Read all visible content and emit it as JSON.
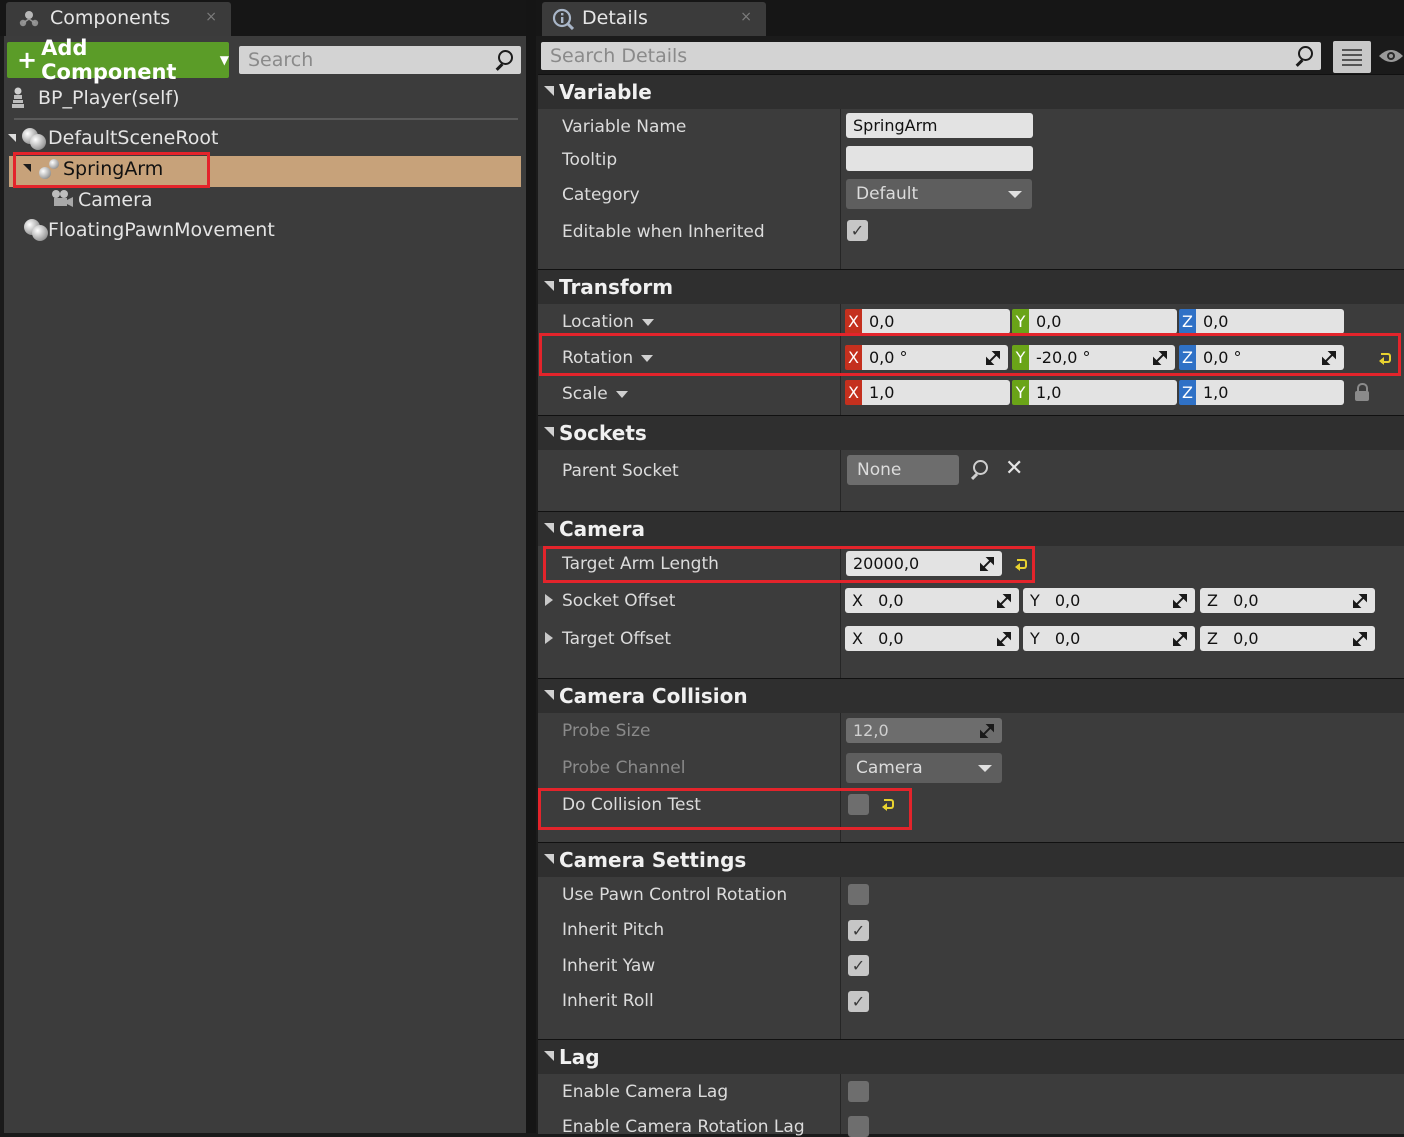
{
  "components_panel": {
    "tab_title": "Components",
    "tab_close": "×",
    "add_component_label": "Add Component",
    "search_placeholder": "Search",
    "self_item": "BP_Player(self)",
    "tree": [
      {
        "label": "DefaultSceneRoot"
      },
      {
        "label": "SpringArm",
        "selected": true
      },
      {
        "label": "Camera"
      },
      {
        "label": "FloatingPawnMovement"
      }
    ]
  },
  "details_panel": {
    "tab_title": "Details",
    "tab_close": "×",
    "search_placeholder": "Search Details",
    "sections": {
      "variable": {
        "title": "Variable",
        "variable_name_label": "Variable Name",
        "variable_name_value": "SpringArm",
        "tooltip_label": "Tooltip",
        "tooltip_value": "",
        "category_label": "Category",
        "category_value": "Default",
        "editable_label": "Editable when Inherited",
        "editable_checked": true
      },
      "transform": {
        "title": "Transform",
        "location_label": "Location",
        "location": {
          "x": "0,0",
          "y": "0,0",
          "z": "0,0"
        },
        "rotation_label": "Rotation",
        "rotation": {
          "x": "0,0 °",
          "y": "-20,0 °",
          "z": "0,0 °"
        },
        "scale_label": "Scale",
        "scale": {
          "x": "1,0",
          "y": "1,0",
          "z": "1,0"
        },
        "axis_x": "X",
        "axis_y": "Y",
        "axis_z": "Z"
      },
      "sockets": {
        "title": "Sockets",
        "parent_socket_label": "Parent Socket",
        "parent_socket_value": "None"
      },
      "camera": {
        "title": "Camera",
        "target_arm_length_label": "Target Arm Length",
        "target_arm_length_value": "20000,0",
        "socket_offset_label": "Socket Offset",
        "socket_offset": {
          "x": "0,0",
          "y": "0,0",
          "z": "0,0"
        },
        "target_offset_label": "Target Offset",
        "target_offset": {
          "x": "0,0",
          "y": "0,0",
          "z": "0,0"
        }
      },
      "camera_collision": {
        "title": "Camera Collision",
        "probe_size_label": "Probe Size",
        "probe_size_value": "12,0",
        "probe_channel_label": "Probe Channel",
        "probe_channel_value": "Camera",
        "do_collision_test_label": "Do Collision Test",
        "do_collision_test_checked": false
      },
      "camera_settings": {
        "title": "Camera Settings",
        "use_pawn_control_rotation_label": "Use Pawn Control Rotation",
        "use_pawn_control_rotation_checked": false,
        "inherit_pitch_label": "Inherit Pitch",
        "inherit_pitch_checked": true,
        "inherit_yaw_label": "Inherit Yaw",
        "inherit_yaw_checked": true,
        "inherit_roll_label": "Inherit Roll",
        "inherit_roll_checked": true
      },
      "lag": {
        "title": "Lag",
        "enable_camera_lag_label": "Enable Camera Lag",
        "enable_camera_lag_checked": false,
        "enable_camera_rotation_lag_label": "Enable Camera Rotation Lag",
        "enable_camera_rotation_lag_checked": false
      }
    }
  },
  "colors": {
    "accent_green": "#5b9c28",
    "selection": "#c7a27a",
    "highlight_red": "#e3242b",
    "axis_x": "#c4301e",
    "axis_y": "#6aa418",
    "axis_z": "#2f71c6",
    "reset_yellow": "#e8d230"
  },
  "icons": {
    "components_tab": "components-icon",
    "details_tab": "details-icon",
    "add": "plus-icon",
    "search": "search-icon",
    "reset": "reset-to-default-icon",
    "spin": "drag-spinner-icon",
    "lock": "lock-icon",
    "view_options": "list-view-icon",
    "visibility": "eye-icon"
  },
  "check_glyph": "✓"
}
